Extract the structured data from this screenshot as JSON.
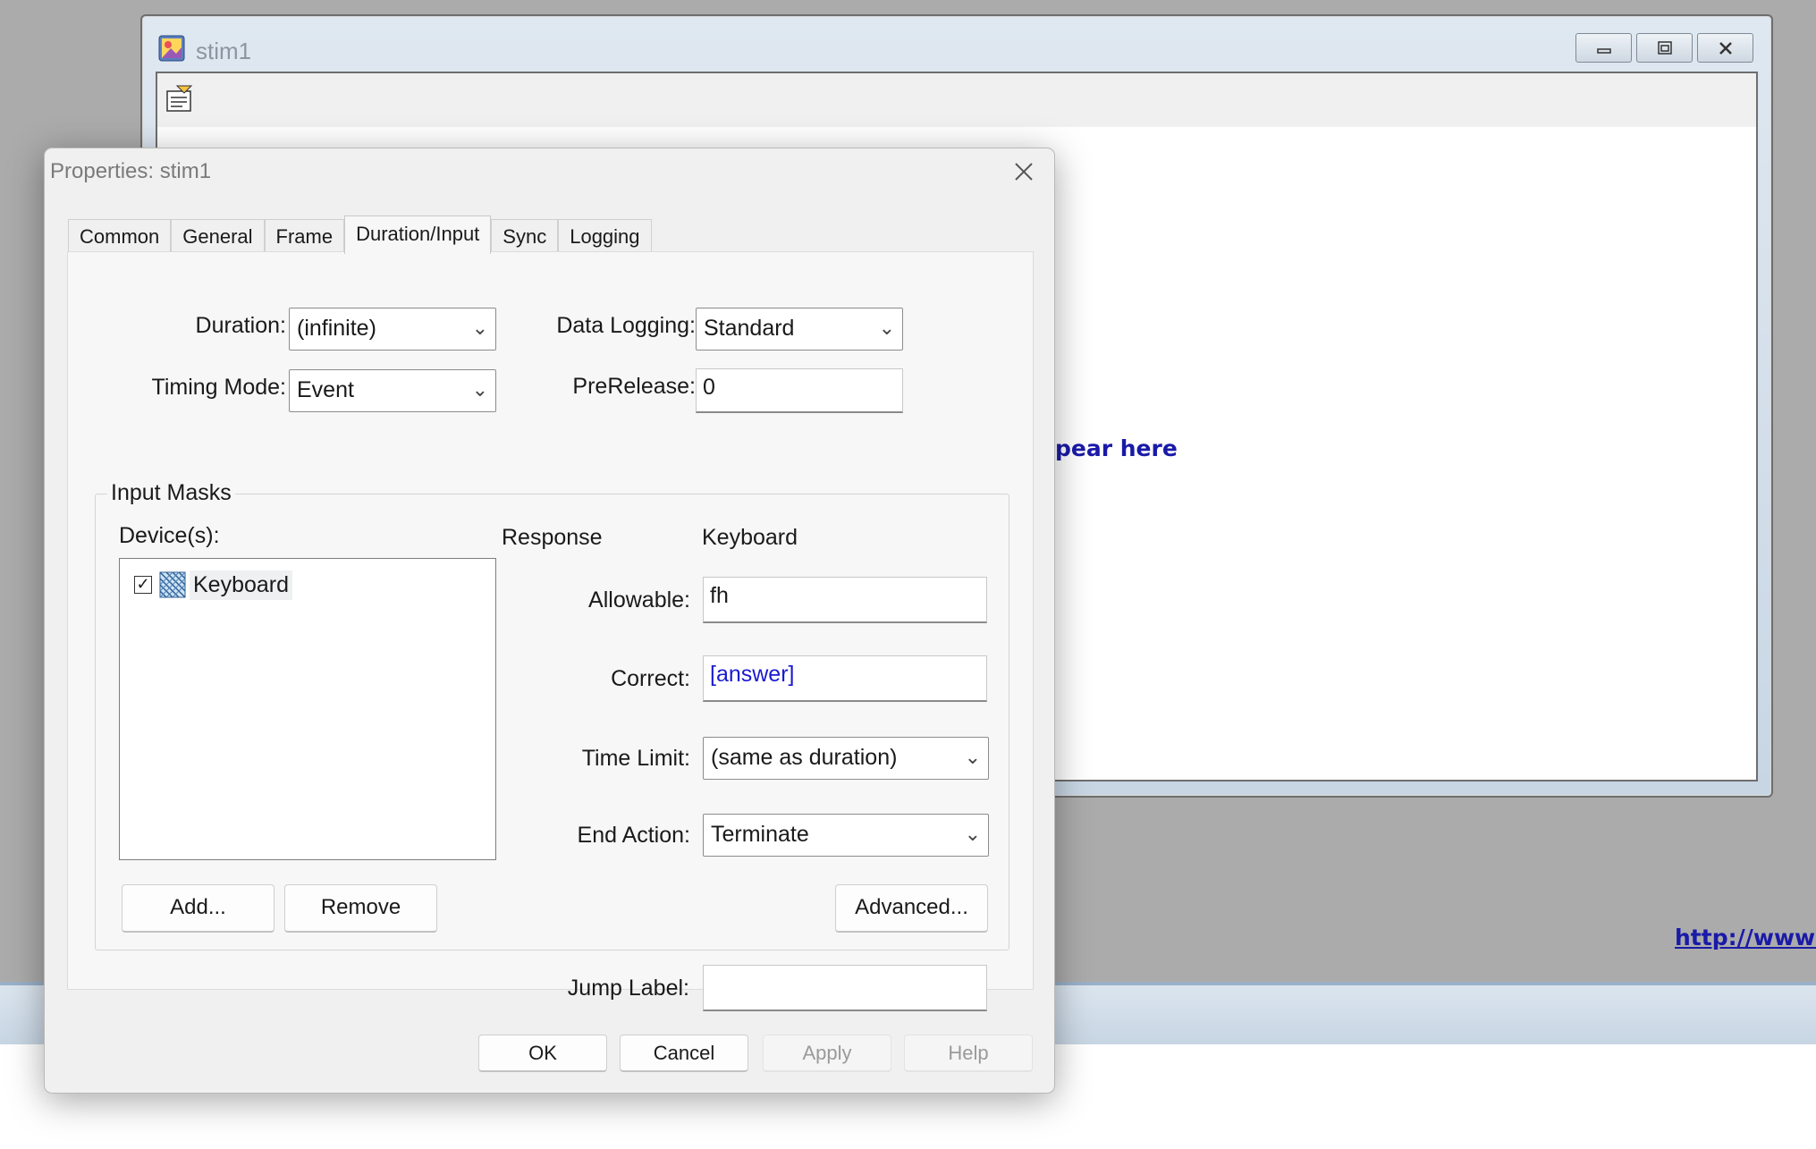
{
  "host_window": {
    "title": "stim1",
    "controls": [
      "minimize",
      "restore",
      "close"
    ],
    "canvas_text": "pear here",
    "link_text": "http://www.p"
  },
  "dialog": {
    "title": "Properties: stim1",
    "tabs": [
      {
        "label": "Common"
      },
      {
        "label": "General"
      },
      {
        "label": "Frame"
      },
      {
        "label": "Duration/Input",
        "active": true
      },
      {
        "label": "Sync"
      },
      {
        "label": "Logging"
      }
    ],
    "fields": {
      "duration_label": "Duration:",
      "duration_value": "(infinite)",
      "data_logging_label": "Data Logging:",
      "data_logging_value": "Standard",
      "timing_mode_label": "Timing Mode:",
      "timing_mode_value": "Event",
      "prerelease_label": "PreRelease:",
      "prerelease_value": "0"
    },
    "input_masks": {
      "legend": "Input Masks",
      "devices_label": "Device(s):",
      "devices": [
        {
          "name": "Keyboard",
          "checked": true
        }
      ],
      "response_label": "Response",
      "response_device": "Keyboard",
      "allowable_label": "Allowable:",
      "allowable_value": "fh",
      "correct_label": "Correct:",
      "correct_value": "[answer]",
      "correct_color": "#1a1ad0",
      "time_limit_label": "Time Limit:",
      "time_limit_value": "(same as duration)",
      "end_action_label": "End Action:",
      "end_action_value": "Terminate",
      "add_button": "Add...",
      "remove_button": "Remove",
      "advanced_button": "Advanced..."
    },
    "jump_label": "Jump Label:",
    "jump_value": "",
    "buttons": {
      "ok": "OK",
      "cancel": "Cancel",
      "apply": "Apply",
      "help": "Help"
    }
  }
}
